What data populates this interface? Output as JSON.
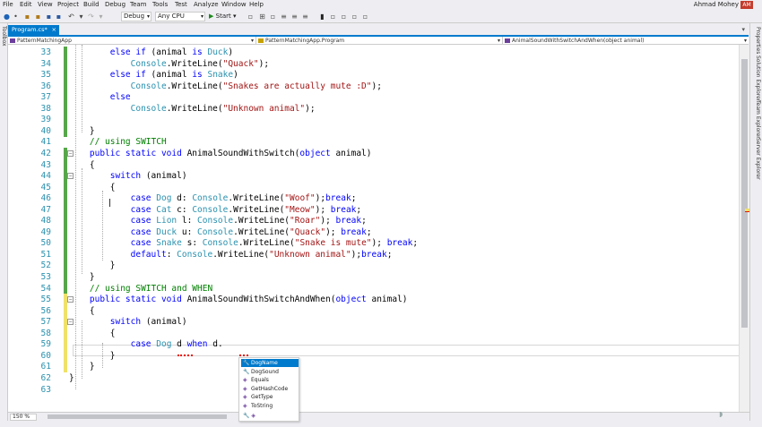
{
  "menu": [
    "File",
    "Edit",
    "View",
    "Project",
    "Build",
    "Debug",
    "Team",
    "Tools",
    "Test",
    "Analyze",
    "Window",
    "Help"
  ],
  "user": {
    "name": "Ahmad Mohey",
    "initials": "AM"
  },
  "toolbar": {
    "config": "Debug",
    "platform": "Any CPU",
    "start": "Start"
  },
  "left_panel": {
    "label": "Toolbox"
  },
  "right_panel": {
    "labels": [
      "Properties",
      "Solution Explorer",
      "Team Explorer",
      "Server Explorer"
    ]
  },
  "tab": {
    "name": "Program.cs*",
    "close": "×"
  },
  "nav": {
    "project": "PatternMatchingApp",
    "type": "PatternMatchingApp.Program",
    "member": "AnimalSoundWithSwitchAndWhen(object animal)"
  },
  "code_lines": [
    {
      "n": "33",
      "html": "        <span class=\"kw\">else if</span> (animal <span class=\"kw\">is</span> <span class=\"tp\">Duck</span>)"
    },
    {
      "n": "34",
      "html": "            <span class=\"tp\">Console</span>.WriteLine(<span class=\"st\">\"Quack\"</span>);"
    },
    {
      "n": "35",
      "html": "        <span class=\"kw\">else if</span> (animal <span class=\"kw\">is</span> <span class=\"tp\">Snake</span>)"
    },
    {
      "n": "36",
      "html": "            <span class=\"tp\">Console</span>.WriteLine(<span class=\"st\">\"Snakes are actually mute :D\"</span>);"
    },
    {
      "n": "37",
      "html": "        <span class=\"kw\">else</span>"
    },
    {
      "n": "38",
      "html": "            <span class=\"tp\">Console</span>.WriteLine(<span class=\"st\">\"Unknown animal\"</span>);"
    },
    {
      "n": "39",
      "html": ""
    },
    {
      "n": "40",
      "html": "    }"
    },
    {
      "n": "41",
      "html": "    <span class=\"cm\">// using SWITCH</span>"
    },
    {
      "n": "42",
      "html": "    <span class=\"kw\">public static void</span> AnimalSoundWithSwitch(<span class=\"kw\">object</span> animal)"
    },
    {
      "n": "43",
      "html": "    {"
    },
    {
      "n": "44",
      "html": "        <span class=\"kw\">switch</span> (animal)"
    },
    {
      "n": "45",
      "html": "        {"
    },
    {
      "n": "46",
      "html": "            <span class=\"kw\">case</span> <span class=\"tp\">Dog</span> d: <span class=\"tp\">Console</span>.WriteLine(<span class=\"st\">\"Woof\"</span>);<span class=\"kw\">break</span>;"
    },
    {
      "n": "47",
      "html": "            <span class=\"kw\">case</span> <span class=\"tp\">Cat</span> c: <span class=\"tp\">Console</span>.WriteLine(<span class=\"st\">\"Meow\"</span>); <span class=\"kw\">break</span>;"
    },
    {
      "n": "48",
      "html": "            <span class=\"kw\">case</span> <span class=\"tp\">Lion</span> l: <span class=\"tp\">Console</span>.WriteLine(<span class=\"st\">\"Roar\"</span>); <span class=\"kw\">break</span>;"
    },
    {
      "n": "49",
      "html": "            <span class=\"kw\">case</span> <span class=\"tp\">Duck</span> u: <span class=\"tp\">Console</span>.WriteLine(<span class=\"st\">\"Quack\"</span>); <span class=\"kw\">break</span>;"
    },
    {
      "n": "50",
      "html": "            <span class=\"kw\">case</span> <span class=\"tp\">Snake</span> s: <span class=\"tp\">Console</span>.WriteLine(<span class=\"st\">\"Snake is mute\"</span>); <span class=\"kw\">break</span>;"
    },
    {
      "n": "51",
      "html": "            <span class=\"kw\">default</span>: <span class=\"tp\">Console</span>.WriteLine(<span class=\"st\">\"Unknown animal\"</span>);<span class=\"kw\">break</span>;"
    },
    {
      "n": "52",
      "html": "        }"
    },
    {
      "n": "53",
      "html": "    }"
    },
    {
      "n": "54",
      "html": "    <span class=\"cm\">// using SWITCH and WHEN</span>"
    },
    {
      "n": "55",
      "html": "    <span class=\"kw\">public static void</span> AnimalSoundWithSwitchAndWhen(<span class=\"kw\">object</span> animal)"
    },
    {
      "n": "56",
      "html": "    {"
    },
    {
      "n": "57",
      "html": "        <span class=\"kw\">switch</span> (animal)"
    },
    {
      "n": "58",
      "html": "        {"
    },
    {
      "n": "59",
      "html": "            <span class=\"kw\">case</span> <span class=\"tp\">Dog</span> d <span class=\"kw\">when</span> d."
    },
    {
      "n": "60",
      "html": "        }"
    },
    {
      "n": "61",
      "html": "    }"
    },
    {
      "n": "62",
      "html": "}"
    },
    {
      "n": "63",
      "html": ""
    }
  ],
  "completion": {
    "items": [
      {
        "label": "DogName",
        "icon": "wrench-icon",
        "selected": true
      },
      {
        "label": "DogSound",
        "icon": "wrench-icon",
        "selected": false
      },
      {
        "label": "Equals",
        "icon": "method-icon",
        "selected": false
      },
      {
        "label": "GetHashCode",
        "icon": "method-icon",
        "selected": false
      },
      {
        "label": "GetType",
        "icon": "method-icon",
        "selected": false
      },
      {
        "label": "ToString",
        "icon": "method-icon",
        "selected": false
      }
    ]
  },
  "zoom": "150 %",
  "colors": {
    "accent": "#007acc",
    "keyword": "#0000ff",
    "type": "#2b91af",
    "string": "#a31515",
    "comment": "#008000",
    "changed": "#57a64a",
    "unsaved": "#efe16a"
  }
}
